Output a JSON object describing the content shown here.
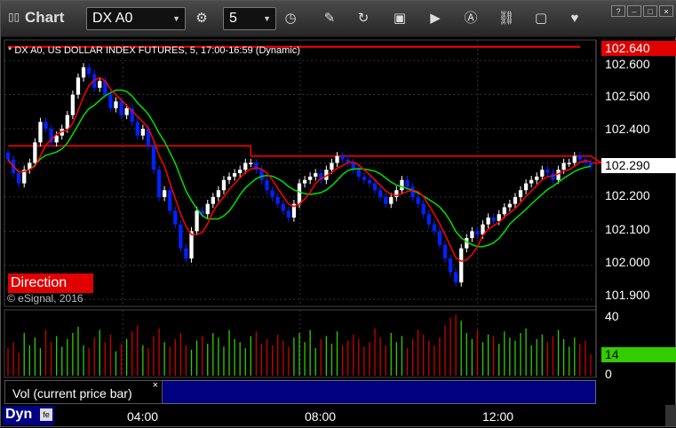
{
  "window": {
    "app_title": "Chart",
    "symbol": "DX A0",
    "interval": "5",
    "toolbar_icons": [
      "interval-clock-icon",
      "time-clock-icon",
      "pencil-draw-icon",
      "refresh-icon",
      "get-data-icon",
      "play-icon",
      "alert-icon",
      "link-icon",
      "chat-icon",
      "twitter-icon"
    ],
    "toolbar_icon_glyphs": [
      "⚙",
      "◷",
      "✎",
      "↻",
      "▣",
      "▶",
      "Ⓐ",
      "⛓",
      "▢",
      "♥"
    ]
  },
  "chart": {
    "header": "* DX A0, US DOLLAR INDEX FUTURES, 5, 17:00-16:59 (Dynamic)",
    "direction_label": "Direction",
    "copyright": "© eSignal, 2016",
    "price_axis": [
      "102.600",
      "102.500",
      "102.400",
      "102.200",
      "102.100",
      "102.000",
      "101.900"
    ],
    "price_tags": [
      {
        "value": "102.640",
        "bg": "#e00000",
        "fg": "#ffffff"
      },
      {
        "value": "102.290",
        "bg": "#ffffff",
        "fg": "#000000"
      }
    ],
    "time_axis": [
      "04:00",
      "08:00",
      "12:00"
    ],
    "colors": {
      "up": "#ffffff",
      "down": "#0022ff",
      "ma_fast": "#00e000",
      "ma_slow": "#ff0000",
      "level": "#ff0000"
    }
  },
  "volume": {
    "axis": [
      "40",
      "0"
    ],
    "current_tag": {
      "value": "14",
      "bg": "#33cc00"
    },
    "legend": "Vol (current price bar)",
    "close_glyph": "×"
  },
  "status": {
    "dyn_label": "Dyn",
    "dyn_icon": "fe"
  },
  "chart_data": {
    "type": "candlestick",
    "title": "DX A0, US DOLLAR INDEX FUTURES, 5, 17:00-16:59 (Dynamic)",
    "ylim": [
      101.88,
      102.66
    ],
    "y_ticks": [
      101.9,
      102.0,
      102.1,
      102.2,
      102.3,
      102.4,
      102.5,
      102.6
    ],
    "x_ticks": [
      "04:00",
      "08:00",
      "12:00"
    ],
    "resistance_level": 102.64,
    "last_price": 102.29,
    "step_line": [
      {
        "from": 0,
        "to": 45,
        "value": 102.35
      },
      {
        "from": 45,
        "to": 110,
        "value": 102.32
      },
      {
        "from": 110,
        "to": 150,
        "value": 102.3
      }
    ],
    "close": [
      102.31,
      102.27,
      102.24,
      102.28,
      102.3,
      102.36,
      102.42,
      102.4,
      102.36,
      102.38,
      102.4,
      102.44,
      102.5,
      102.55,
      102.58,
      102.56,
      102.52,
      102.54,
      102.5,
      102.46,
      102.48,
      102.44,
      102.46,
      102.42,
      102.38,
      102.4,
      102.35,
      102.28,
      102.2,
      102.22,
      102.16,
      102.12,
      102.05,
      102.02,
      102.1,
      102.16,
      102.15,
      102.18,
      102.2,
      102.22,
      102.25,
      102.26,
      102.27,
      102.28,
      102.3,
      102.3,
      102.28,
      102.25,
      102.22,
      102.2,
      102.18,
      102.16,
      102.14,
      102.18,
      102.24,
      102.25,
      102.26,
      102.27,
      102.25,
      102.28,
      102.3,
      102.32,
      102.31,
      102.3,
      102.28,
      102.26,
      102.25,
      102.24,
      102.22,
      102.2,
      102.18,
      102.2,
      102.22,
      102.25,
      102.23,
      102.2,
      102.18,
      102.15,
      102.12,
      102.1,
      102.06,
      102.02,
      101.98,
      101.95,
      102.05,
      102.08,
      102.1,
      102.09,
      102.12,
      102.14,
      102.13,
      102.15,
      102.17,
      102.18,
      102.2,
      102.22,
      102.24,
      102.25,
      102.26,
      102.28,
      102.27,
      102.25,
      102.28,
      102.3,
      102.3,
      102.32,
      102.31,
      102.3,
      102.29
    ],
    "volume": [
      18,
      22,
      15,
      28,
      20,
      25,
      18,
      30,
      22,
      26,
      19,
      24,
      28,
      32,
      20,
      18,
      25,
      30,
      22,
      27,
      16,
      21,
      24,
      29,
      33,
      20,
      18,
      26,
      31,
      22,
      19,
      24,
      28,
      20,
      17,
      23,
      26,
      21,
      28,
      25,
      19,
      30,
      24,
      22,
      18,
      26,
      29,
      21,
      24,
      20,
      27,
      23,
      19,
      25,
      28,
      22,
      30,
      18,
      24,
      26,
      21,
      29,
      20,
      23,
      27,
      24,
      19,
      22,
      31,
      25,
      20,
      28,
      22,
      26,
      18,
      24,
      30,
      27,
      23,
      20,
      25,
      33,
      38,
      40,
      36,
      28,
      24,
      30,
      22,
      27,
      26,
      21,
      29,
      25,
      23,
      28,
      31,
      20,
      24,
      27,
      22,
      26,
      30,
      24,
      19,
      25,
      21,
      23,
      14
    ]
  }
}
